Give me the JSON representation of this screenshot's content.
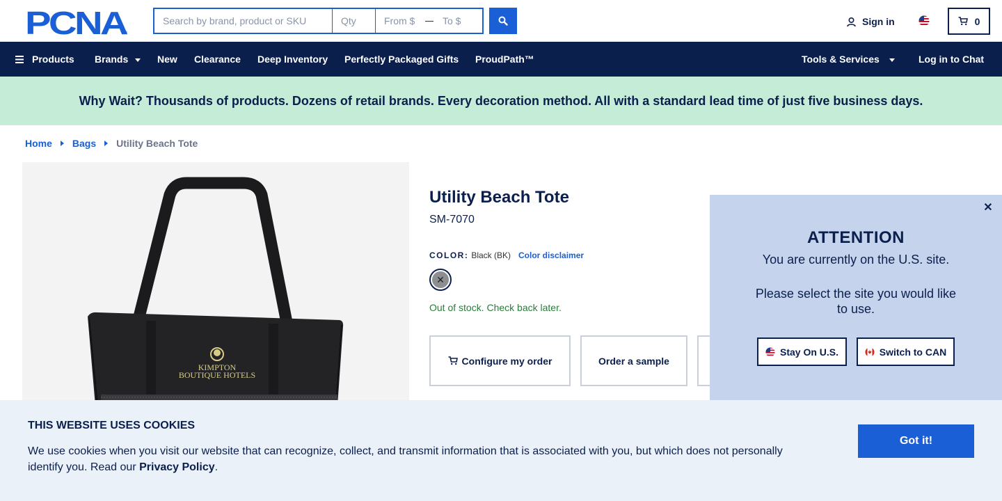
{
  "header": {
    "logo_text": "PCNA",
    "search": {
      "main_placeholder": "Search by brand, product or SKU",
      "qty_placeholder": "Qty",
      "from_placeholder": "From $",
      "to_placeholder": "To $"
    },
    "sign_in": "Sign in",
    "cart_count": "0"
  },
  "nav": {
    "products": "Products",
    "brands": "Brands",
    "new": "New",
    "clearance": "Clearance",
    "deep_inventory": "Deep Inventory",
    "gifts": "Perfectly Packaged Gifts",
    "proudpath": "ProudPath™",
    "tools": "Tools & Services",
    "chat": "Log in to Chat"
  },
  "banner": {
    "text": "Why Wait? Thousands of products. Dozens of retail brands. Every decoration method. All with a standard lead time of just five business days."
  },
  "breadcrumb": {
    "home": "Home",
    "bags": "Bags",
    "current": "Utility Beach Tote"
  },
  "product": {
    "title": "Utility Beach Tote",
    "sku": "SM-7070",
    "color_label": "COLOR:",
    "color_value": "Black (BK)",
    "color_disclaimer": "Color disclaimer",
    "stock_status": "Out of stock. Check back later.",
    "imprint_line1": "KIMPTON",
    "imprint_line2": "BOUTIQUE HOTELS",
    "actions": {
      "configure": "Configure my order",
      "sample": "Order a sample"
    }
  },
  "attention": {
    "title": "ATTENTION",
    "line1": "You are currently on the U.S. site.",
    "line2": "Please select the site you would like to use.",
    "stay_us": "Stay On U.S.",
    "switch_can": "Switch to CAN"
  },
  "cookies": {
    "title": "THIS WEBSITE USES COOKIES",
    "text": "We use cookies when you visit our website that can recognize, collect, and transmit information that is associated with you, but which does not personally identify you. Read our ",
    "link": "Privacy Policy",
    "end": ".",
    "button": "Got it!"
  },
  "colors": {
    "navy": "#0b1f4d",
    "blue": "#1a5fd6",
    "banner_green": "#c4ecd6",
    "modal_blue": "#c5d4ec",
    "cookie_bg": "#ebf1f9",
    "stock_green": "#2a7d3a"
  }
}
